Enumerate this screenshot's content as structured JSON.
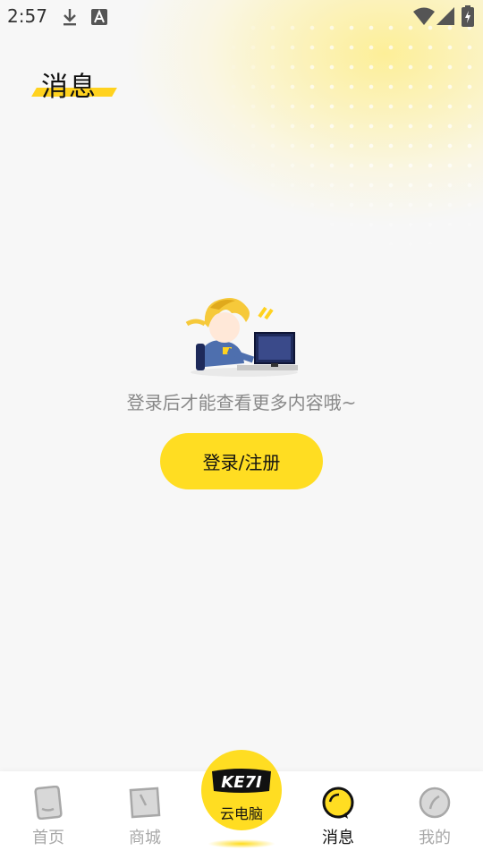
{
  "status_bar": {
    "time": "2:57",
    "icons": [
      "download-icon",
      "font-a-icon",
      "wifi-icon",
      "signal-icon",
      "battery-charging-icon"
    ]
  },
  "header": {
    "title": "消息"
  },
  "empty_state": {
    "message": "登录后才能查看更多内容哦~",
    "button_label": "登录/注册",
    "illustration": "character-at-computer-illustration"
  },
  "colors": {
    "accent": "#ffdd22",
    "inactive": "#a8a8a8",
    "active": "#111111"
  },
  "bottom_nav": {
    "items": [
      {
        "label": "首页",
        "icon": "home-icon",
        "active": false
      },
      {
        "label": "商城",
        "icon": "store-icon",
        "active": false
      },
      {
        "label": "云电脑",
        "icon": "cloud-pc-logo-icon",
        "active": false
      },
      {
        "label": "消息",
        "icon": "message-icon",
        "active": true
      },
      {
        "label": "我的",
        "icon": "profile-icon",
        "active": false
      }
    ],
    "center_logo_text": "KE7I"
  }
}
